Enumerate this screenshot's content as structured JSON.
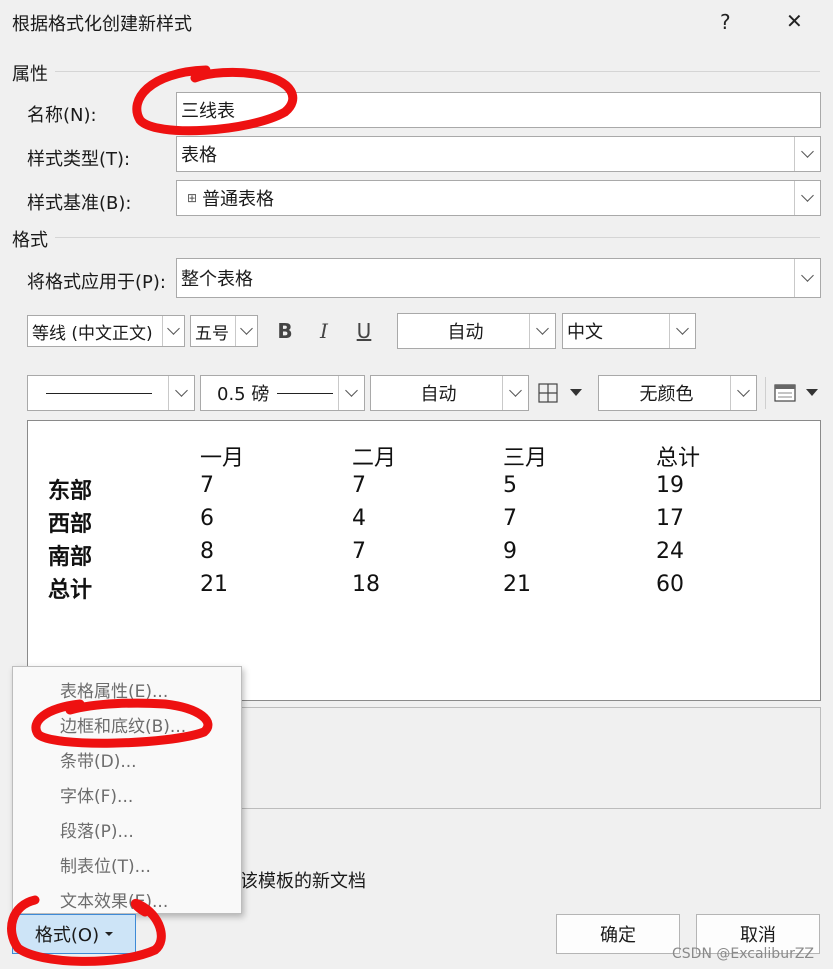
{
  "dialog": {
    "title": "根据格式化创建新样式",
    "help_glyph": "?",
    "close_glyph": "✕"
  },
  "properties": {
    "section_label": "属性",
    "name_label": "名称(N):",
    "name_value": "三线表",
    "type_label": "样式类型(T):",
    "type_value": "表格",
    "base_label": "样式基准(B):",
    "base_value": "普通表格"
  },
  "format": {
    "section_label": "格式",
    "apply_label": "将格式应用于(P):",
    "apply_value": "整个表格",
    "font_value": "等线 (中文正文)",
    "size_value": "五号",
    "bold": "B",
    "italic": "I",
    "underline": "U",
    "color_value": "自动",
    "lang_value": "中文",
    "border_width_value": "0.5 磅",
    "border_color_value": "自动",
    "shading_value": "无颜色"
  },
  "preview_table": {
    "headers": [
      "",
      "一月",
      "二月",
      "三月",
      "总计"
    ],
    "rows": [
      [
        "东部",
        "7",
        "7",
        "5",
        "19"
      ],
      [
        "西部",
        "6",
        "4",
        "7",
        "17"
      ],
      [
        "南部",
        "8",
        "7",
        "9",
        "24"
      ],
      [
        "总计",
        "21",
        "18",
        "21",
        "60"
      ]
    ]
  },
  "context_menu": {
    "items": [
      "表格属性(E)...",
      "边框和底纹(B)...",
      "条带(D)...",
      "字体(F)...",
      "段落(P)...",
      "制表位(T)...",
      "文本效果(E)..."
    ]
  },
  "template_option_partial": "该模板的新文档",
  "buttons": {
    "format": "格式(O)",
    "ok": "确定",
    "cancel": "取消"
  },
  "watermark": "CSDN @ExcaliburZZ",
  "annotation_color": "#ee1111"
}
